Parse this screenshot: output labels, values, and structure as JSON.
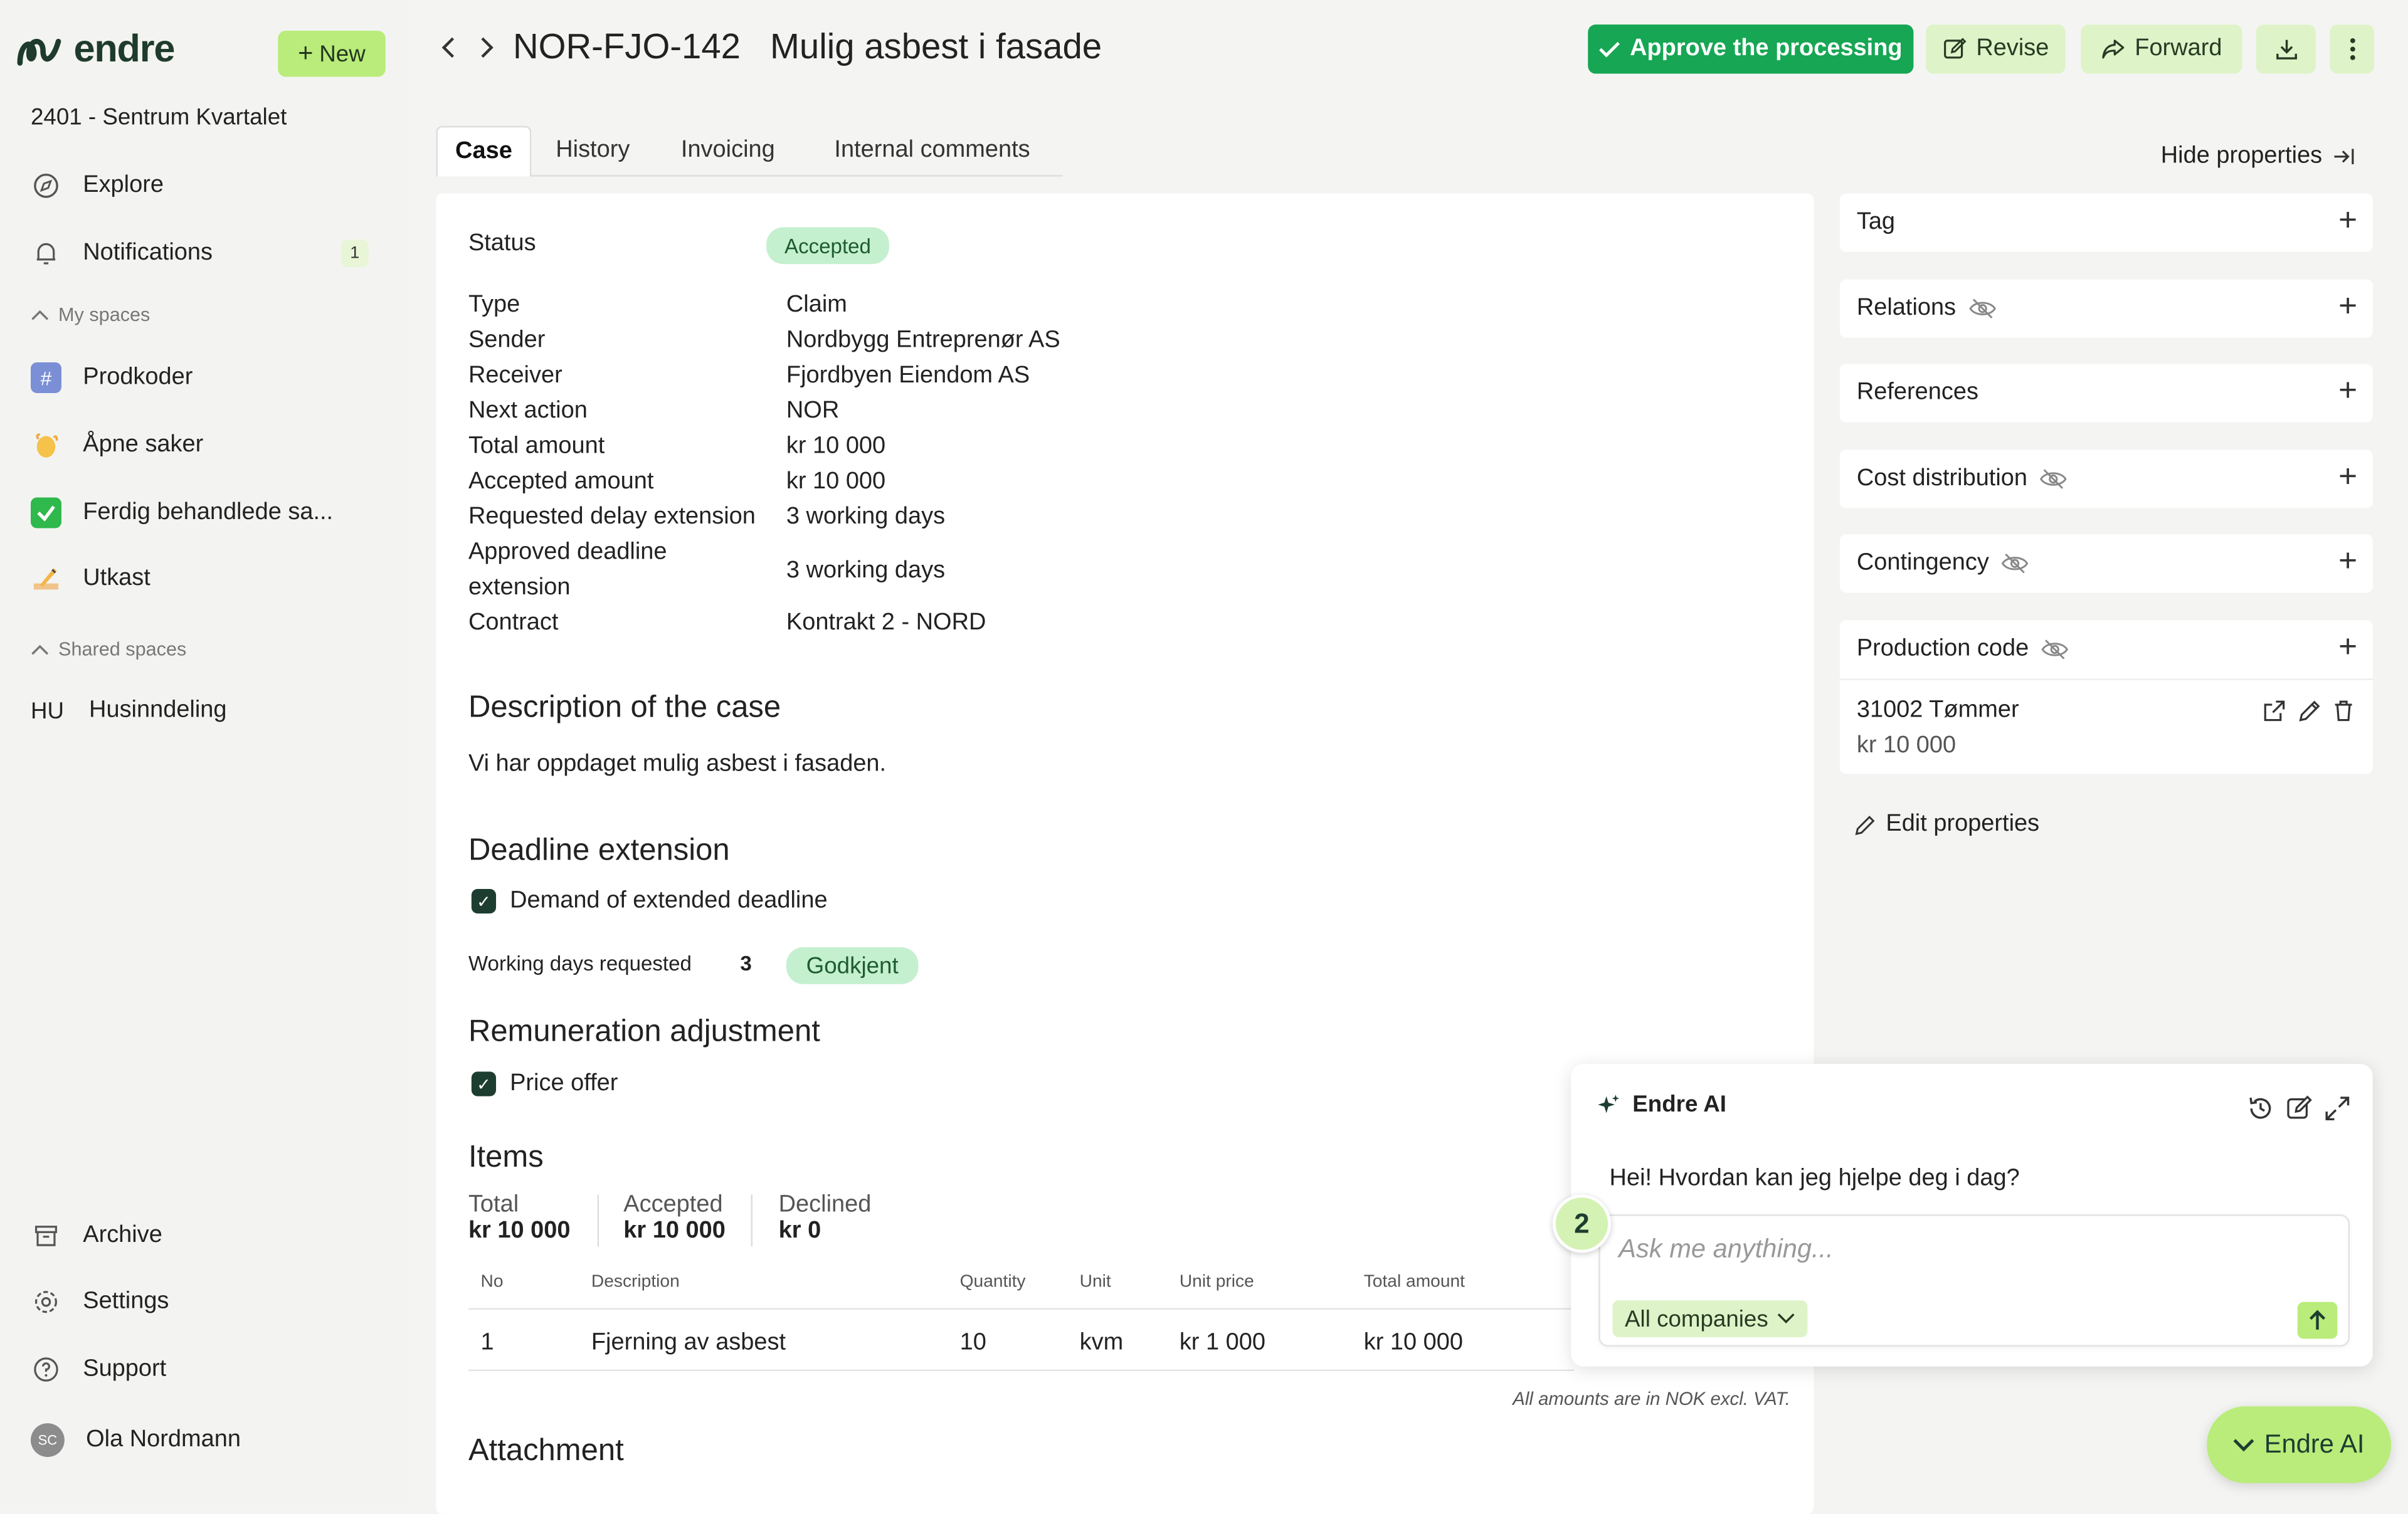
{
  "app": {
    "name": "endre",
    "new_label": "New",
    "project": "2401 - Sentrum Kvartalet"
  },
  "sidebar": {
    "explore": "Explore",
    "notifications": "Notifications",
    "notifications_count": "1",
    "my_spaces_label": "My spaces",
    "my_spaces": [
      {
        "label": "Prodkoder",
        "icon": "hash-icon"
      },
      {
        "label": "Åpne saker",
        "icon": "wave-icon"
      },
      {
        "label": "Ferdig behandlede sa...",
        "icon": "checkmark-icon"
      },
      {
        "label": "Utkast",
        "icon": "writing-hand-icon"
      }
    ],
    "shared_spaces_label": "Shared spaces",
    "shared_spaces": [
      {
        "abbr": "HU",
        "label": "Husinndeling"
      }
    ],
    "archive": "Archive",
    "settings": "Settings",
    "support": "Support",
    "user_initials": "SC",
    "user_name": "Ola Nordmann"
  },
  "header": {
    "case_id": "NOR-FJO-142",
    "case_title": "Mulig asbest i fasade",
    "approve_label": "Approve the processing",
    "revise_label": "Revise",
    "forward_label": "Forward"
  },
  "tabs": [
    "Case",
    "History",
    "Invoicing",
    "Internal comments"
  ],
  "hide_properties": "Hide properties",
  "case": {
    "status_label": "Status",
    "status_value": "Accepted",
    "props": [
      {
        "label": "Type",
        "value": "Claim"
      },
      {
        "label": "Sender",
        "value": "Nordbygg Entreprenør AS"
      },
      {
        "label": "Receiver",
        "value": "Fjordbyen Eiendom AS"
      },
      {
        "label": "Next action",
        "value": "NOR"
      },
      {
        "label": "Total amount",
        "value": "kr 10 000"
      },
      {
        "label": "Accepted amount",
        "value": "kr 10 000"
      },
      {
        "label": "Requested delay extension",
        "value": "3 working days"
      },
      {
        "label": "Approved deadline",
        "label2": "extension",
        "value": "3 working days"
      },
      {
        "label": "Contract",
        "value": "Kontrakt 2 - NORD"
      }
    ],
    "description_heading": "Description of the case",
    "description_text": "Vi har oppdaget mulig asbest i fasaden.",
    "deadline_heading": "Deadline extension",
    "deadline_check": "Demand of extended deadline",
    "working_days_label": "Working days requested",
    "working_days_value": "3",
    "working_days_status": "Godkjent",
    "remuneration_heading": "Remuneration adjustment",
    "price_offer": "Price offer",
    "items_heading": "Items",
    "items_summary": [
      {
        "label": "Total",
        "value": "kr 10 000"
      },
      {
        "label": "Accepted",
        "value": "kr 10 000"
      },
      {
        "label": "Declined",
        "value": "kr 0"
      }
    ],
    "items_columns": [
      "No",
      "Description",
      "Quantity",
      "Unit",
      "Unit price",
      "Total amount"
    ],
    "items_rows": [
      {
        "no": "1",
        "description": "Fjerning av asbest",
        "quantity": "10",
        "unit": "kvm",
        "unit_price": "kr 1 000",
        "total": "kr 10 000"
      }
    ],
    "vat_note": "All amounts are in NOK excl. VAT.",
    "attachment_heading": "Attachment"
  },
  "properties_panel": {
    "tag": "Tag",
    "relations": "Relations",
    "references": "References",
    "cost_distribution": "Cost distribution",
    "contingency": "Contingency",
    "production_code": "Production code",
    "production_code_item": "31002 Tømmer",
    "production_code_amount": "kr 10 000",
    "edit_properties": "Edit properties"
  },
  "ai": {
    "title": "Endre AI",
    "greeting": "Hei! Hvordan kan jeg hjelpe deg i dag?",
    "placeholder": "Ask me anything...",
    "scope": "All companies",
    "step_badge": "2",
    "fab_label": "Endre AI"
  },
  "colors": {
    "primary_green": "#17a654",
    "accent_lime": "#b9ec7a",
    "status_pill": "#c4f0cf"
  }
}
